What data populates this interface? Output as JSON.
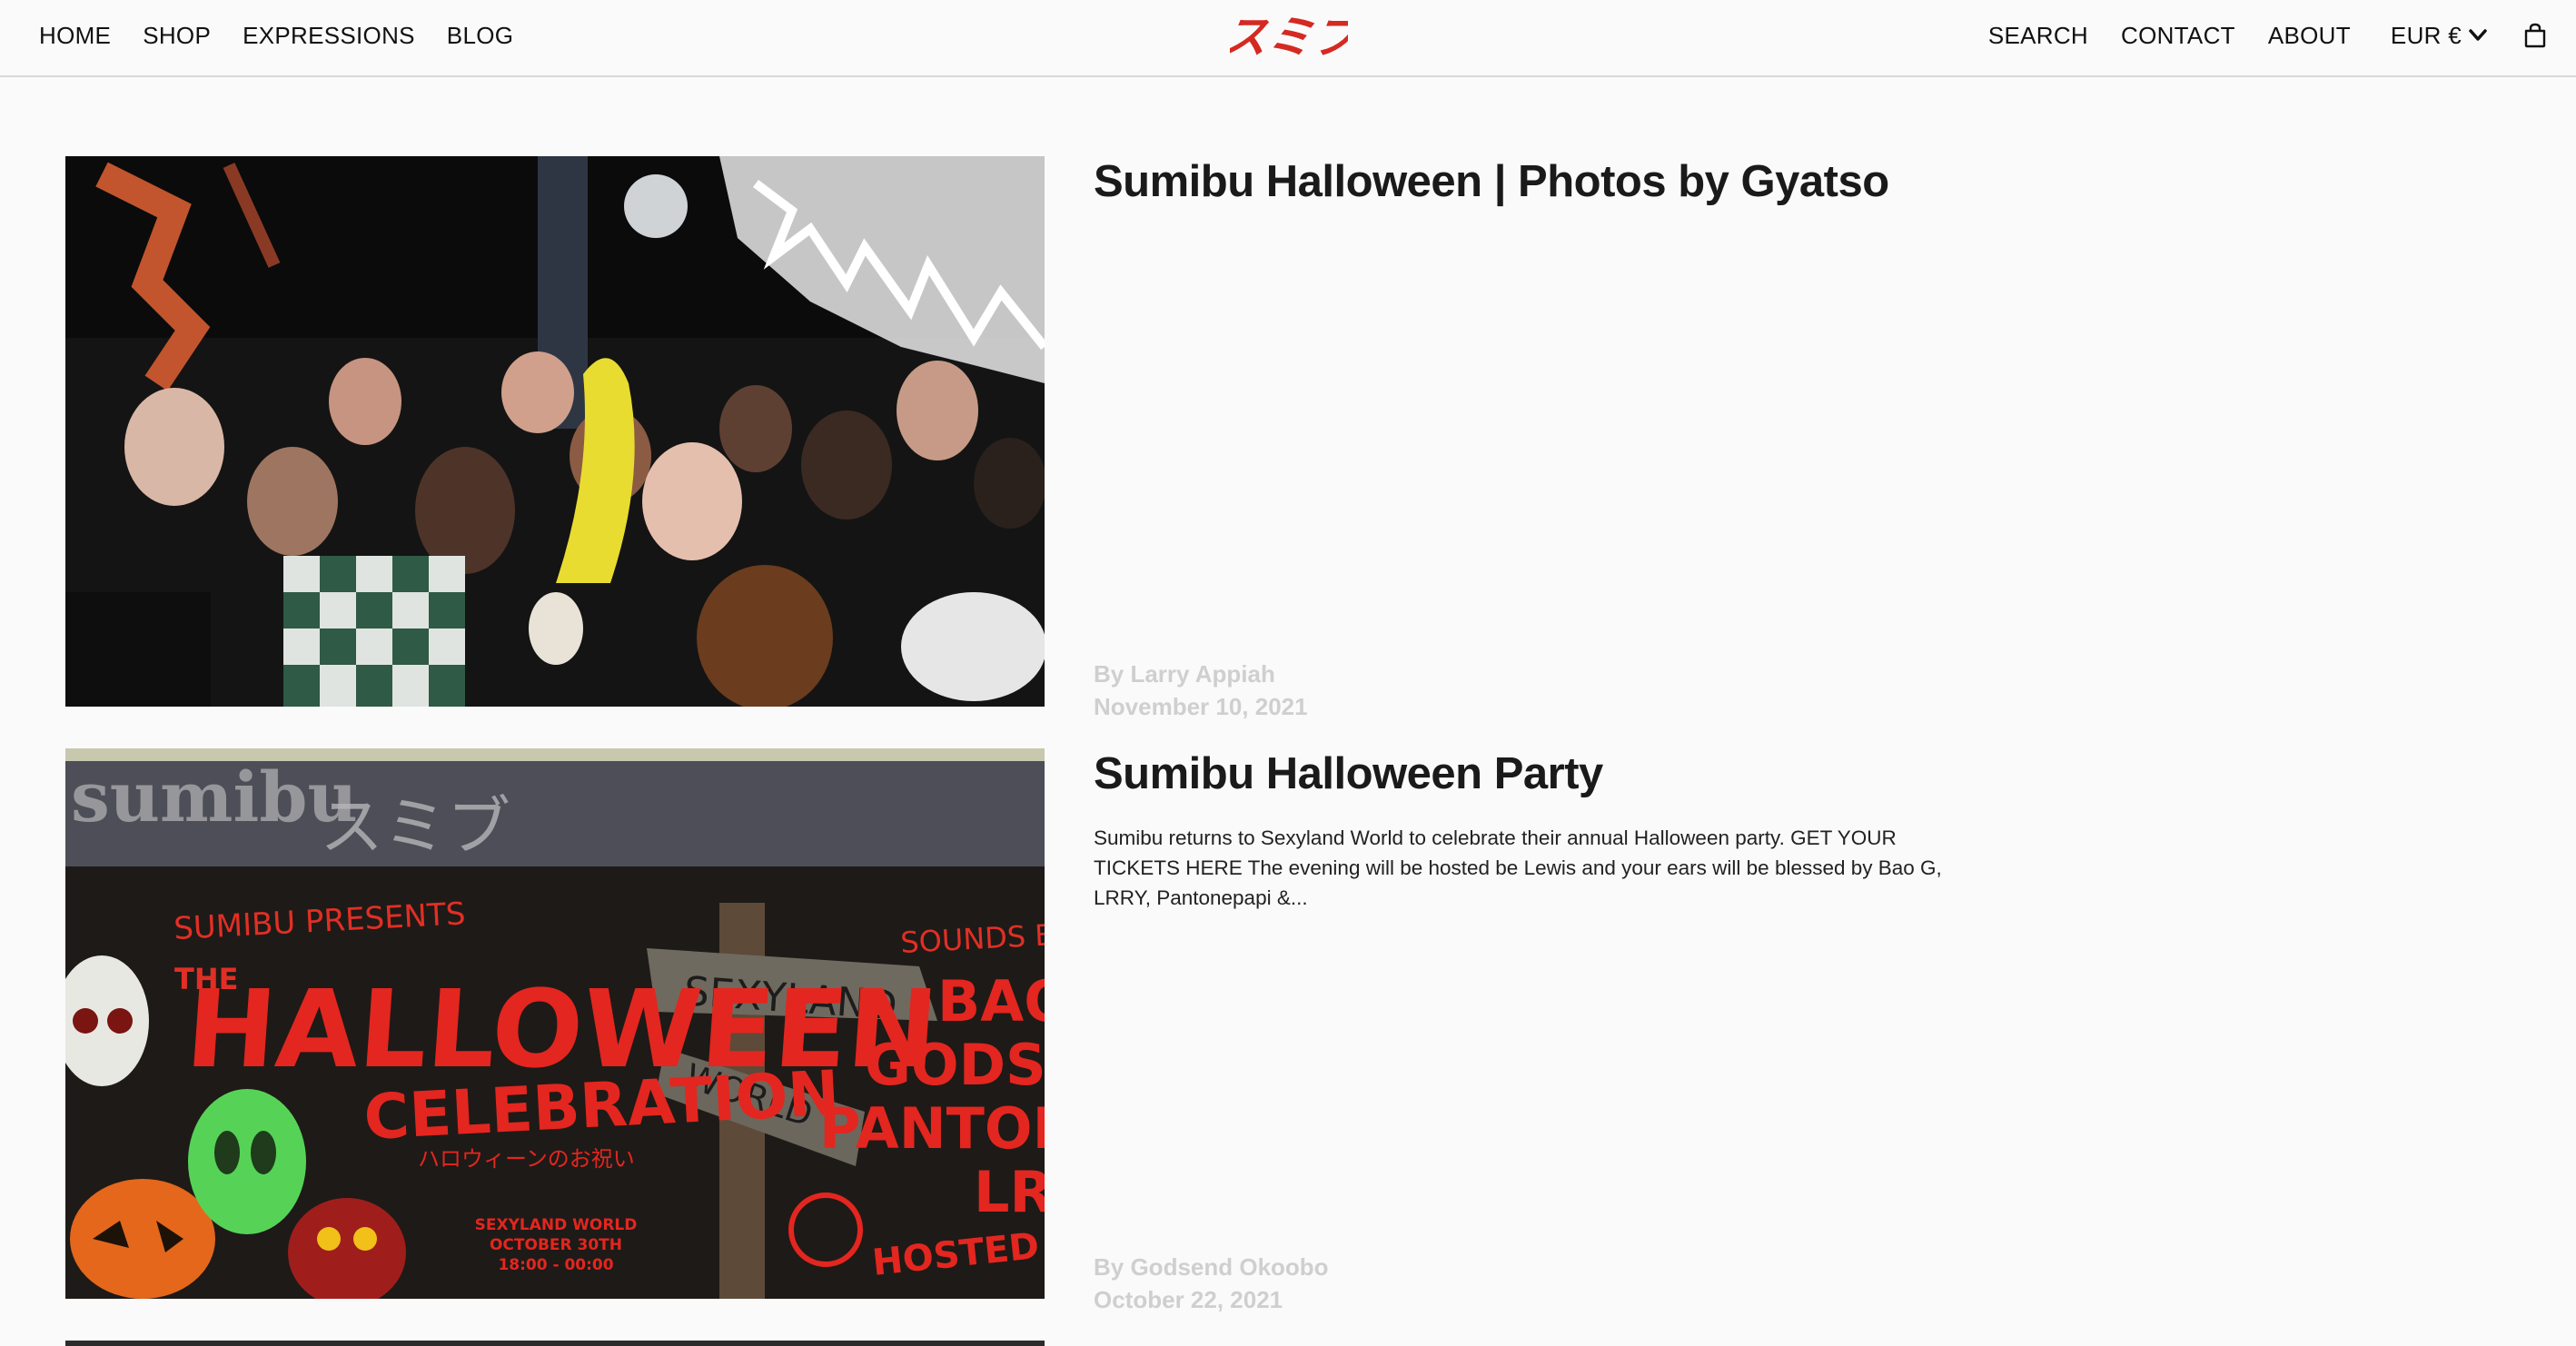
{
  "nav": {
    "left": [
      "HOME",
      "SHOP",
      "EXPRESSIONS",
      "BLOG"
    ],
    "right": [
      "SEARCH",
      "CONTACT",
      "ABOUT"
    ],
    "currency": "EUR €"
  },
  "logo": {
    "text": "スミブ",
    "color": "#d42a22"
  },
  "posts": [
    {
      "title": "Sumibu Halloween | Photos by Gyatso",
      "excerpt": "",
      "author": "By Larry Appiah",
      "date": "November 10, 2021",
      "image": "party-crowd-photo"
    },
    {
      "title": "Sumibu Halloween Party",
      "excerpt": "Sumibu returns to Sexyland World to celebrate their annual Halloween party. GET YOUR TICKETS HERE The evening will be hosted be Lewis and your ears will be blessed by Bao G, LRRY, Pantonepapi &...",
      "author": "By Godsend Okoobo",
      "date": "October 22, 2021",
      "image": "halloween-poster",
      "poster": {
        "wordmark": "sumibu",
        "kana": "スミブ",
        "presents": "SUMIBU PRESENTS",
        "the": "THE",
        "headline": "HALLOWEEN",
        "subhead": "CELEBRATION",
        "jp": "ハロウィーンのお祝い",
        "venue": "SEXYLAND WORLD",
        "date": "OCTOBER 30TH",
        "time": "18:00 - 00:00",
        "sign1": "SEXYLAND",
        "sign2": "WORLD",
        "sounds": "SOUNDS BY",
        "acts": [
          "BAO G",
          "GODSENDO",
          "PANTONEPAPI",
          "LRRY"
        ],
        "host": "HOSTED BY LEWIS"
      }
    }
  ],
  "colors": {
    "accent": "#d42a22",
    "meta": "#cfcfcf",
    "divider": "#d8d8d8"
  }
}
